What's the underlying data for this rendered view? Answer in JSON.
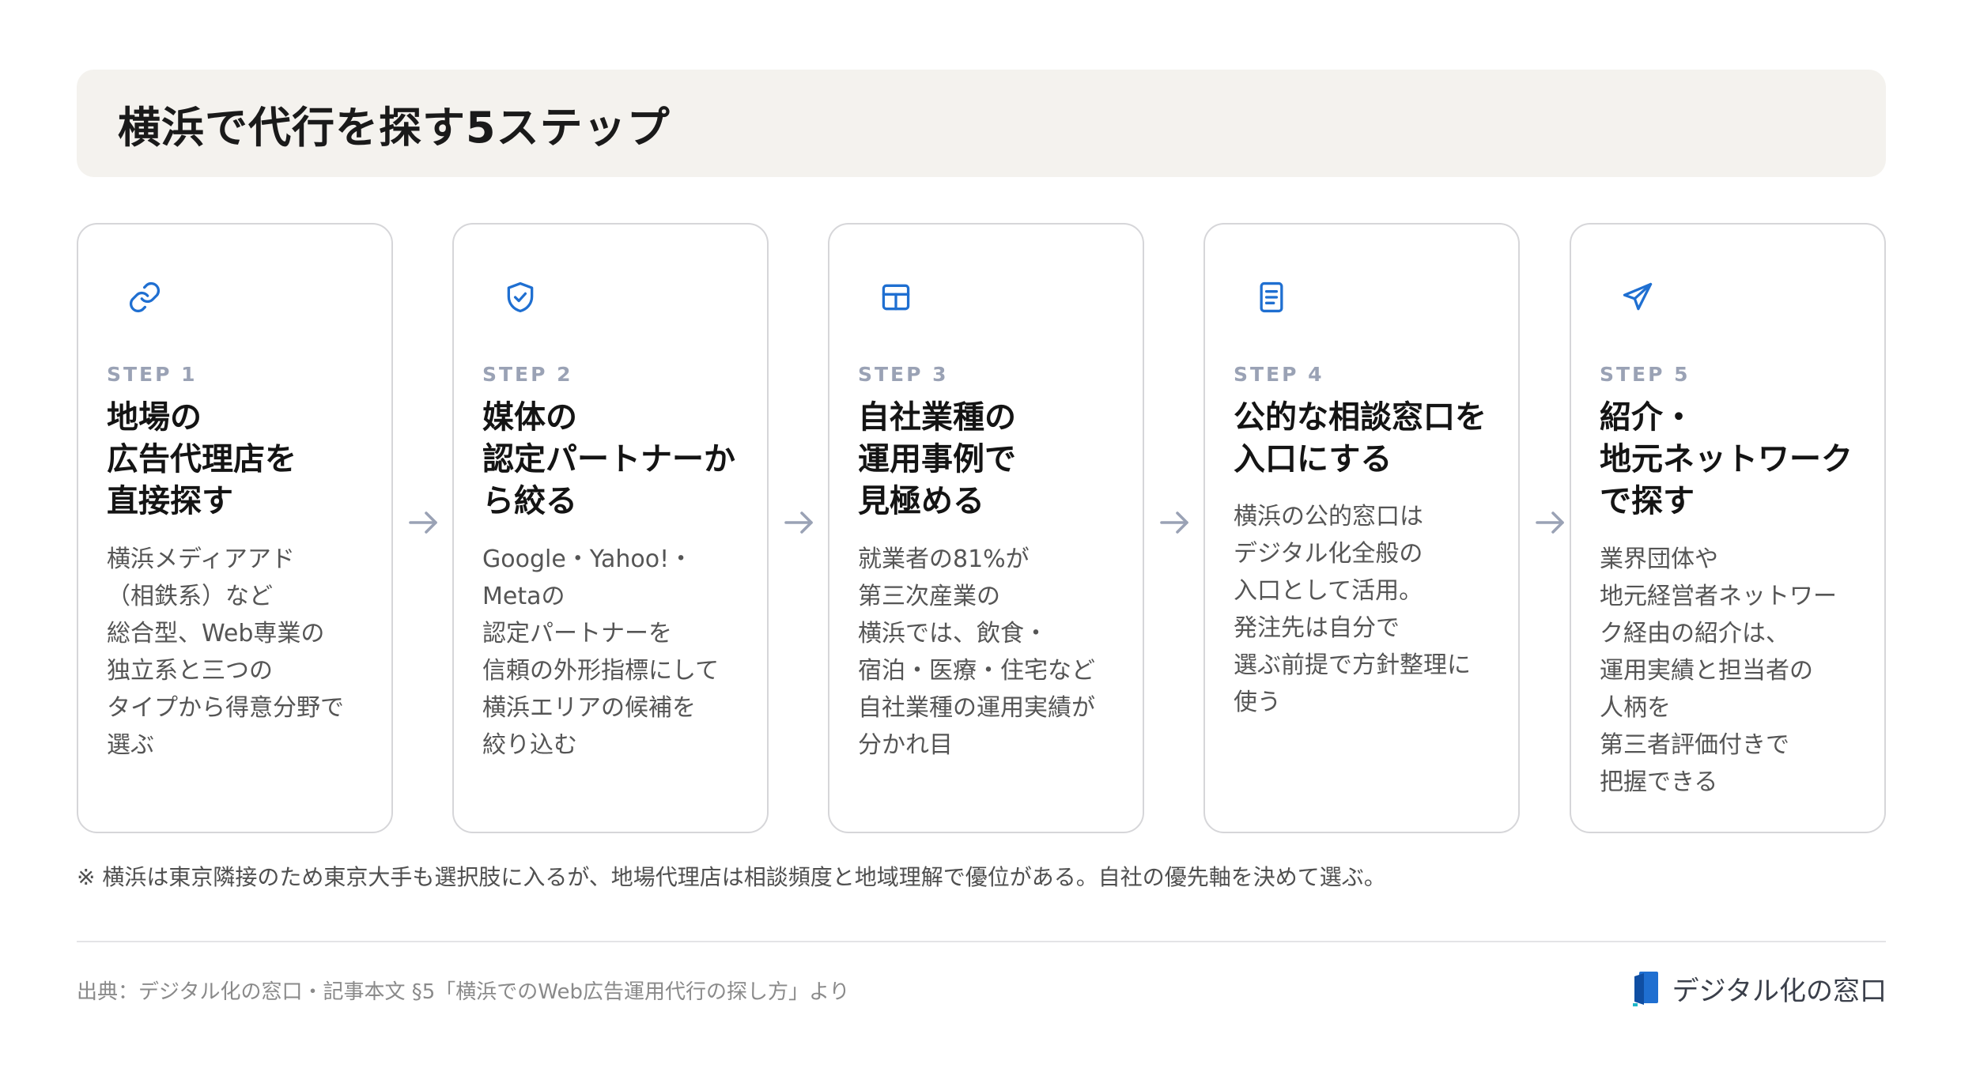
{
  "header": {
    "title": "横浜で代行を探す5ステップ"
  },
  "steps": [
    {
      "icon": "link-icon",
      "label": "STEP 1",
      "title": "地場の\n広告代理店を\n直接探す",
      "description": "横浜メディアアド\n（相鉄系）など\n総合型、Web専業の\n独立系と三つの\nタイプから得意分野で\n選ぶ"
    },
    {
      "icon": "shield-check-icon",
      "label": "STEP 2",
      "title": "媒体の\n認定パートナーか\nら絞る",
      "description": "Google・Yahoo!・\nMetaの\n認定パートナーを\n信頼の外形指標にして\n横浜エリアの候補を\n絞り込む"
    },
    {
      "icon": "grid-icon",
      "label": "STEP 3",
      "title": "自社業種の\n運用事例で\n見極める",
      "description": "就業者の81%が\n第三次産業の\n横浜では、飲食・\n宿泊・医療・住宅など\n自社業種の運用実績が\n分かれ目"
    },
    {
      "icon": "document-icon",
      "label": "STEP 4",
      "title": "公的な相談窓口を\n入口にする",
      "description": "横浜の公的窓口は\nデジタル化全般の\n入口として活用。\n発注先は自分で\n選ぶ前提で方針整理に\n使う"
    },
    {
      "icon": "send-icon",
      "label": "STEP 5",
      "title": "紹介・\n地元ネットワーク\nで探す",
      "description": "業界団体や\n地元経営者ネットワー\nク経由の紹介は、\n運用実績と担当者の\n人柄を\n第三者評価付きで\n把握できる"
    }
  ],
  "note": "※ 横浜は東京隣接のため東京大手も選択肢に入るが、地場代理店は相談頻度と地域理解で優位がある。自社の優先軸を決めて選ぶ。",
  "footer": {
    "source": "出典：デジタル化の窓口・記事本文 §5「横浜でのWeb広告運用代行の探し方」より",
    "brand_name": "デジタル化の窓口"
  },
  "colors": {
    "accent": "#1f6fd1",
    "step_label": "#9aa2b5",
    "card_border": "#d6d6d9",
    "title_bar_bg": "#f4f2ee",
    "arrow": "#9aa2b5"
  }
}
